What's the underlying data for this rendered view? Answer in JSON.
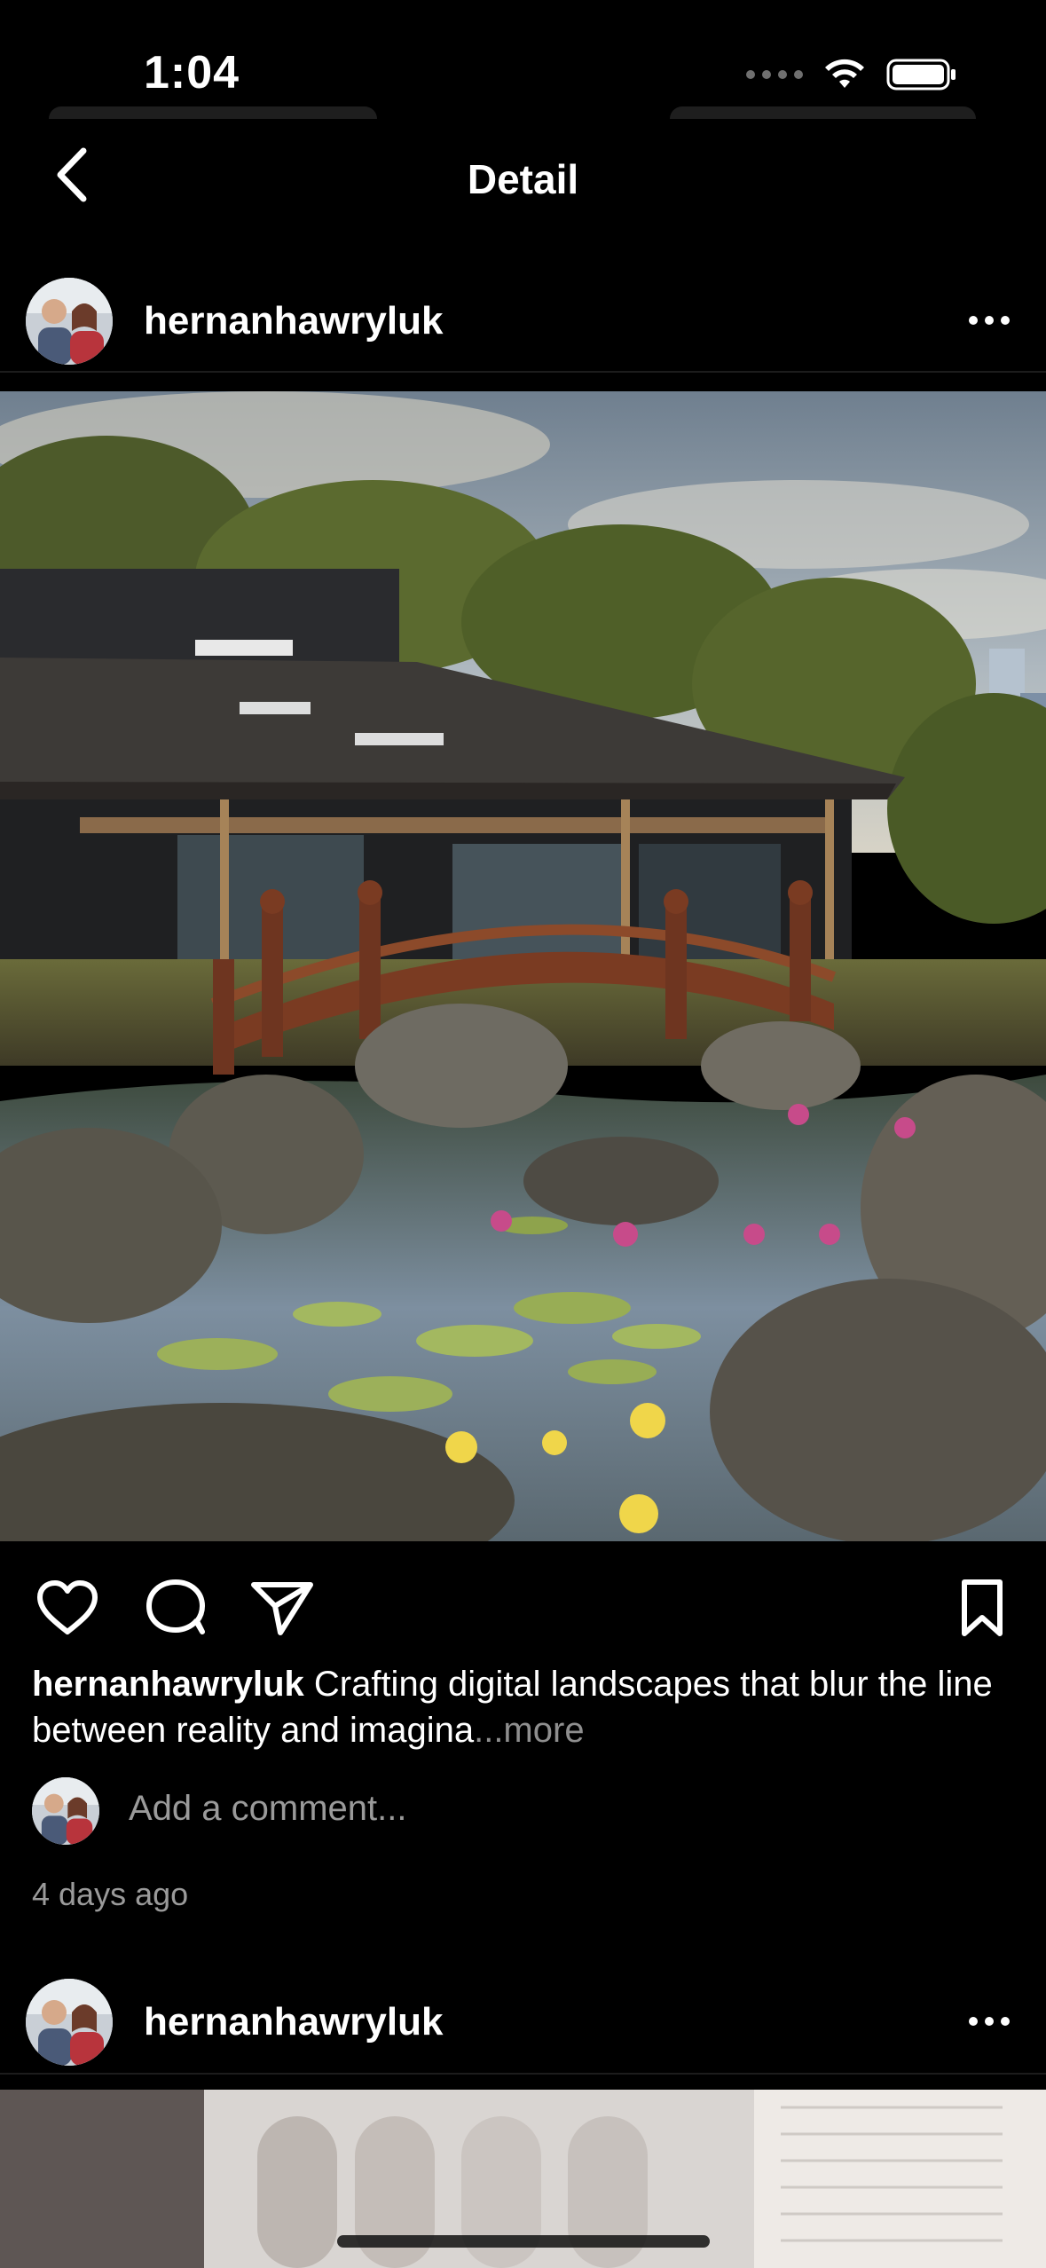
{
  "status_bar": {
    "time": "1:04"
  },
  "nav": {
    "title": "Detail"
  },
  "posts": [
    {
      "username": "hernanhawryluk",
      "caption_user": "hernanhawryluk",
      "caption_text": " Crafting digital landscapes that blur the line between reality and imagina",
      "caption_more": "...more",
      "comment_placeholder": "Add a comment...",
      "timestamp": "4 days ago"
    },
    {
      "username": "hernanhawryluk"
    }
  ],
  "icons": {
    "back": "chevron-left-icon",
    "options": "more-horizontal-icon",
    "like": "heart-icon",
    "comment": "comment-bubble-icon",
    "share": "paper-plane-icon",
    "save": "bookmark-icon"
  },
  "colors": {
    "background": "#000000",
    "text": "#ffffff",
    "secondary_text": "#9a9a9a"
  }
}
